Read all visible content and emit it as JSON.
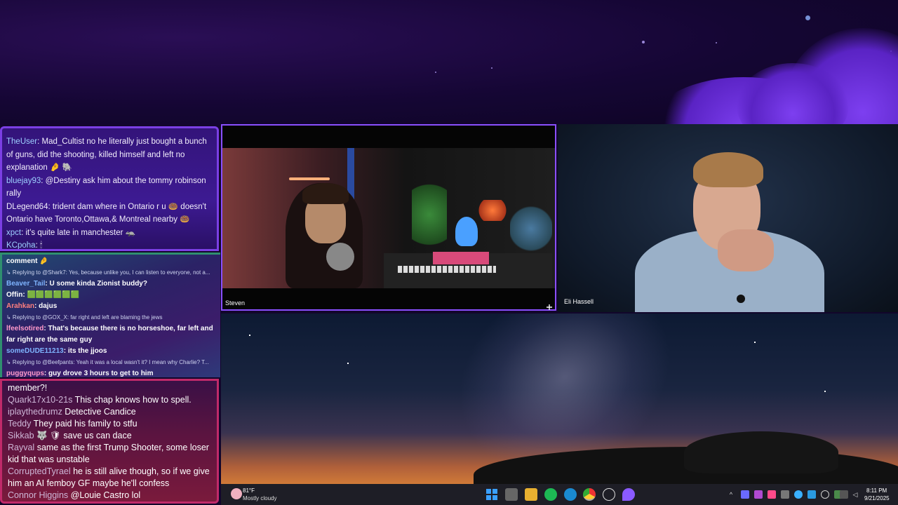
{
  "chat1": {
    "messages": [
      {
        "user": "TheUser",
        "text": ": Mad_Cultist no he literally just bought a bunch of guns, did the shooting, killed himself and left no explanation 🤌 🐘"
      },
      {
        "user": "bluejay93",
        "text": ": @Destiny ask him about the tommy robinson rally"
      },
      {
        "user": "DLegend64",
        "text": ": trident dam where in Ontario r u 🍩 doesn't Ontario have Toronto,Ottawa,& Montreal nearby 🍩"
      },
      {
        "user": "xpct",
        "text": ": it's quite late in manchester 🦡"
      },
      {
        "user": "KCpoha",
        "text": ": 🕯"
      }
    ]
  },
  "chat2": {
    "top_text": "comment 🤌",
    "items": [
      {
        "reply": "↳ Replying to @Shark7: Yes, because unlike you, I can listen to everyone, not a...",
        "user": "Beaver_Tail",
        "ucls": "u-blue",
        "text": " U some kinda Zionist buddy?"
      },
      {
        "reply": "",
        "user": "Offin",
        "ucls": "u-white",
        "text": " 🟩🟩🟩🟩🟩🟩"
      },
      {
        "reply": "",
        "user": "Arahkan",
        "ucls": "u-red",
        "text": " dajus"
      },
      {
        "reply": "↳ Replying to @GOX_X: far right and left are blaming the jews",
        "user": "lfeelsotired",
        "ucls": "u-pink",
        "text": " That's because there is no horseshoe, far left and far right are the same guy"
      },
      {
        "reply": "",
        "user": "someDUDE11213",
        "ucls": "u-blue",
        "text": " its the jjoos"
      },
      {
        "reply": "↳ Replying to @Beefpants: Yeah it was a local wasn't it? I mean why Charlie? T...",
        "user": "puggyqups",
        "ucls": "u-pink",
        "text": " guy drove 3 hours to get to him"
      }
    ]
  },
  "chat3": {
    "top_text": "member?!",
    "messages": [
      {
        "user": "Quark17x10-21s",
        "text": " This chap knows how to spell."
      },
      {
        "user": "iplaythedrumz",
        "text": " Detective Candice"
      },
      {
        "user": "Teddy",
        "text": " They paid his family to stfu"
      },
      {
        "user": "Sikkab",
        "text": " 🐺 🛡 save us can dace"
      },
      {
        "user": "Rayval",
        "text": " same as the first Trump Shooter, some loser kid that was unstable"
      },
      {
        "user": "CorruptedTyrael",
        "text": " he is still alive though, so if we give him an AI femboy GF maybe he'll confess"
      },
      {
        "user": "Connor Higgins",
        "text": " @Louie Castro lol"
      }
    ]
  },
  "video": {
    "left_name": "Steven",
    "right_name": "Eli Hassell",
    "expand_icon": "expand-icon"
  },
  "taskbar": {
    "weather_temp": "81°F",
    "weather_desc": "Mostly cloudy",
    "time": "8:11 PM",
    "date": "9/21/2025",
    "colors": {
      "bg": "#1e1e26",
      "accent": "#8a4fff"
    }
  }
}
